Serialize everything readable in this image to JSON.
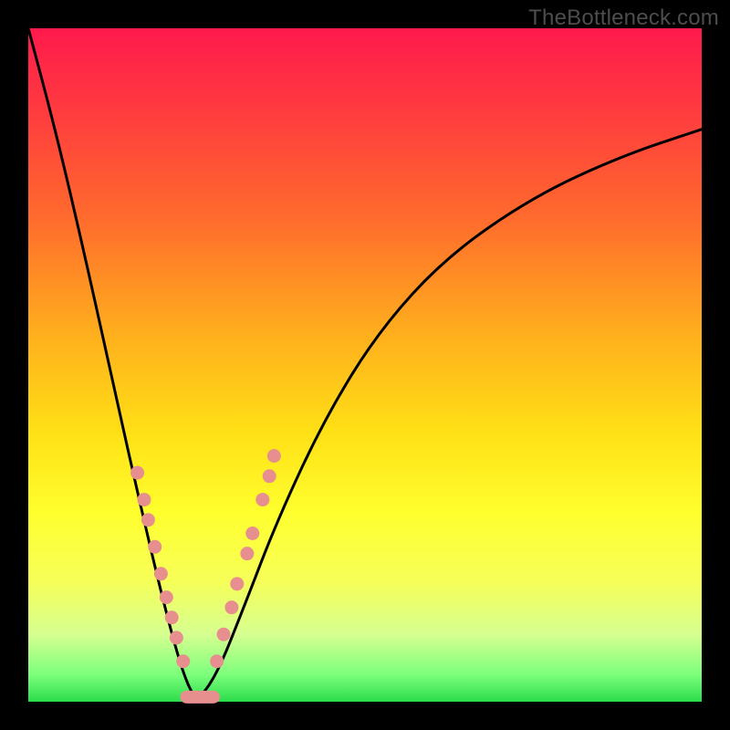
{
  "watermark": "TheBottleneck.com",
  "chart_data": {
    "type": "line",
    "title": "",
    "xlabel": "",
    "ylabel": "",
    "xlim": [
      0,
      100
    ],
    "ylim": [
      0,
      100
    ],
    "description": "V-shaped bottleneck curve with minimum near x≈25; background gradient from red (high bottleneck) at top to green (low bottleneck) at bottom. Pink dots cluster near the trough on both arms.",
    "series": [
      {
        "name": "left-arm",
        "x": [
          0,
          4,
          8,
          12,
          16,
          20,
          23,
          25
        ],
        "y": [
          100,
          85,
          68,
          50,
          32,
          15,
          4,
          0
        ]
      },
      {
        "name": "right-arm",
        "x": [
          25,
          28,
          32,
          37,
          44,
          52,
          62,
          75,
          88,
          100
        ],
        "y": [
          0,
          4,
          14,
          27,
          42,
          55,
          66,
          75,
          81,
          85
        ]
      }
    ],
    "dots_left": [
      {
        "x": 16.2,
        "y": 34
      },
      {
        "x": 17.2,
        "y": 30
      },
      {
        "x": 17.8,
        "y": 27
      },
      {
        "x": 18.8,
        "y": 23
      },
      {
        "x": 19.7,
        "y": 19
      },
      {
        "x": 20.5,
        "y": 15.5
      },
      {
        "x": 21.3,
        "y": 12.5
      },
      {
        "x": 22.0,
        "y": 9.5
      },
      {
        "x": 23.0,
        "y": 6.0
      }
    ],
    "dots_right": [
      {
        "x": 28.0,
        "y": 6.0
      },
      {
        "x": 29.0,
        "y": 10.0
      },
      {
        "x": 30.2,
        "y": 14.0
      },
      {
        "x": 31.0,
        "y": 17.5
      },
      {
        "x": 32.5,
        "y": 22.0
      },
      {
        "x": 33.3,
        "y": 25.0
      },
      {
        "x": 34.8,
        "y": 30.0
      },
      {
        "x": 35.8,
        "y": 33.5
      },
      {
        "x": 36.5,
        "y": 36.5
      }
    ],
    "trough_bar": {
      "x0": 23.5,
      "x1": 27.5,
      "y": 0.7
    },
    "colors": {
      "curve": "#000000",
      "dot_fill": "#e78f8f",
      "dot_stroke": "#c05a5a",
      "gradient_top": "#ff1a4d",
      "gradient_bottom": "#2bdc4a"
    }
  }
}
